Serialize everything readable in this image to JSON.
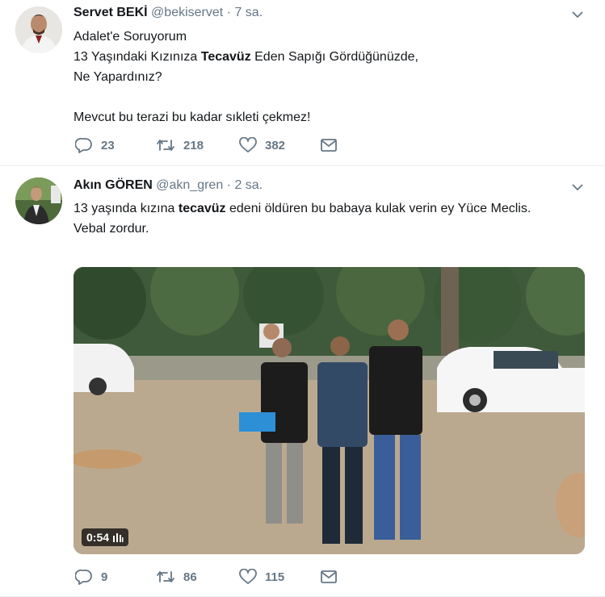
{
  "tweets": [
    {
      "fullname": "Servet BEKİ",
      "username": "@bekiservet",
      "separator": "·",
      "time": "7 sa.",
      "text_parts": {
        "line1": "Adalet'e Soruyorum",
        "line2_before": "13 Yaşındaki Kızınıza ",
        "line2_bold": "Tecavüz",
        "line2_after": " Eden Sapığı Gördüğünüzde,",
        "line3": "Ne Yapardınız?",
        "line5": "Mevcut bu terazi bu kadar sıkleti çekmez!"
      },
      "replies": "23",
      "retweets": "218",
      "likes": "382"
    },
    {
      "fullname": "Akın GÖREN",
      "username": "@akn_gren",
      "separator": "·",
      "time": "2 sa.",
      "text_parts": {
        "line1_before": "13 yaşında kızına ",
        "line1_bold": "tecavüz",
        "line1_after": " edeni öldüren bu babaya kulak verin ey Yüce Meclis.",
        "line2": "Vebal zordur."
      },
      "video_duration": "0:54",
      "replies": "9",
      "retweets": "86",
      "likes": "115"
    }
  ],
  "icons": {
    "reply": "reply-icon",
    "retweet": "retweet-icon",
    "like": "heart-icon",
    "dm": "envelope-icon",
    "menu": "chevron-down-icon",
    "video": "audio-bars-icon"
  },
  "colors": {
    "text": "#14171a",
    "secondary": "#657786",
    "border": "#e6ecf0"
  }
}
